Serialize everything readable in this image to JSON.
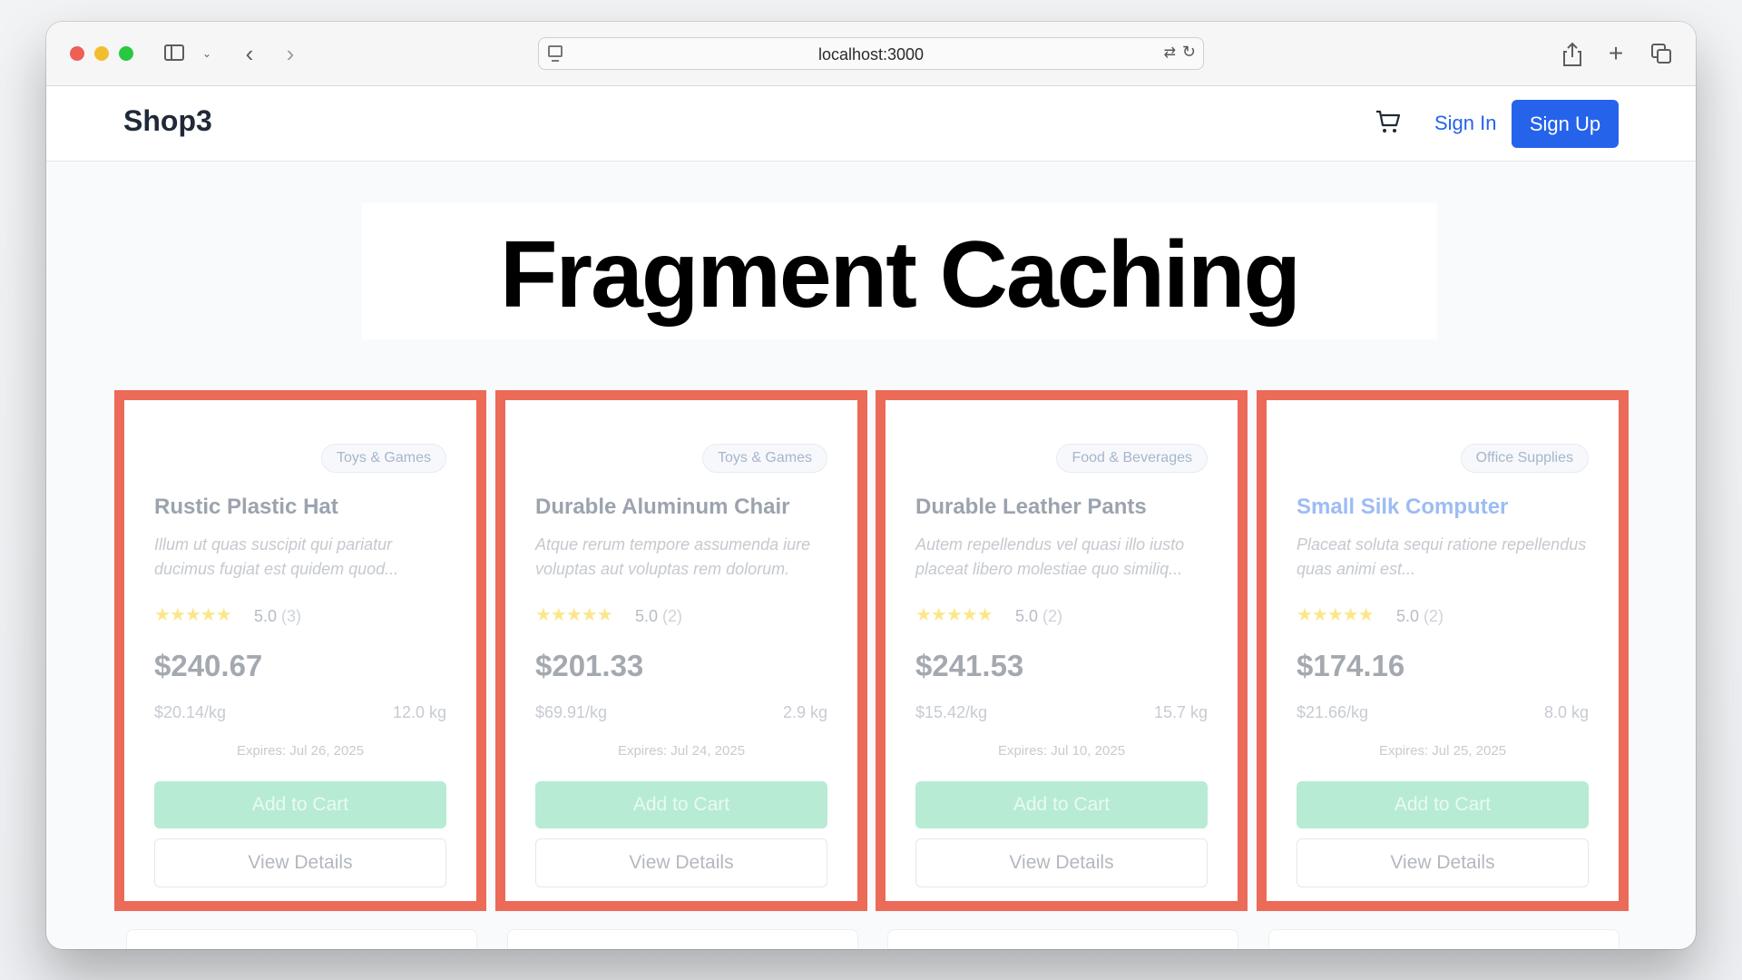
{
  "browser": {
    "url": "localhost:3000",
    "icons": [
      "sidebar-icon",
      "chevron-down-icon",
      "back-icon",
      "forward-icon",
      "page-icon",
      "translate-icon",
      "reload-icon",
      "share-icon",
      "plus-icon",
      "tabs-icon"
    ]
  },
  "header": {
    "brand": "Shop3",
    "sign_in": "Sign In",
    "sign_up": "Sign Up",
    "accent": "#2563eb"
  },
  "overlay_title": "Fragment Caching",
  "highlight_color": "#ec6a58",
  "products": [
    {
      "category": "Toys & Games",
      "name": "Rustic Plastic Hat",
      "description": "Illum ut quas suscipit qui pariatur ducimus fugiat est quidem quod...",
      "stars": "★★★★★",
      "rating": "5.0",
      "review_count": "(3)",
      "price": "$240.67",
      "price_per_kg": "$20.14/kg",
      "weight": "12.0 kg",
      "expires": "Expires: Jul 26, 2025",
      "add_to_cart": "Add to Cart",
      "view_details": "View Details"
    },
    {
      "category": "Toys & Games",
      "name": "Durable Aluminum Chair",
      "description": "Atque rerum tempore assumenda iure voluptas aut voluptas rem dolorum.",
      "stars": "★★★★★",
      "rating": "5.0",
      "review_count": "(2)",
      "price": "$201.33",
      "price_per_kg": "$69.91/kg",
      "weight": "2.9 kg",
      "expires": "Expires: Jul 24, 2025",
      "add_to_cart": "Add to Cart",
      "view_details": "View Details"
    },
    {
      "category": "Food & Beverages",
      "name": "Durable Leather Pants",
      "description": "Autem repellendus vel quasi illo iusto placeat libero molestiae quo similiq...",
      "stars": "★★★★★",
      "rating": "5.0",
      "review_count": "(2)",
      "price": "$241.53",
      "price_per_kg": "$15.42/kg",
      "weight": "15.7 kg",
      "expires": "Expires: Jul 10, 2025",
      "add_to_cart": "Add to Cart",
      "view_details": "View Details"
    },
    {
      "category": "Office Supplies",
      "name": "Small Silk Computer",
      "description": "Placeat soluta sequi ratione repellendus quas animi est...",
      "stars": "★★★★★",
      "rating": "5.0",
      "review_count": "(2)",
      "price": "$174.16",
      "price_per_kg": "$21.66/kg",
      "weight": "8.0 kg",
      "expires": "Expires: Jul 25, 2025",
      "add_to_cart": "Add to Cart",
      "view_details": "View Details"
    }
  ]
}
